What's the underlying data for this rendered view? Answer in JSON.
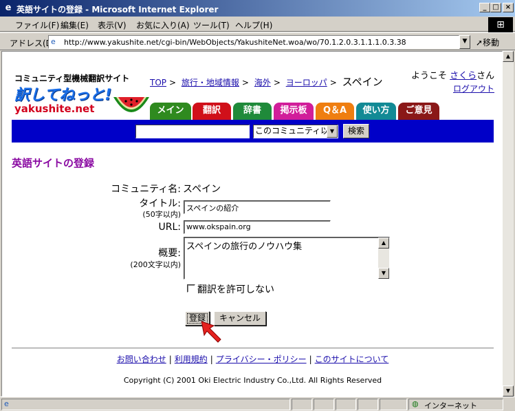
{
  "window": {
    "title": "英語サイトの登録 - Microsoft Internet Explorer",
    "controls": {
      "minimize": "_",
      "maximize": "□",
      "close": "×"
    }
  },
  "menu": {
    "items": [
      "ファイル(F)",
      "編集(E)",
      "表示(V)",
      "お気に入り(A)",
      "ツール(T)",
      "ヘルプ(H)"
    ]
  },
  "address_bar": {
    "label": "アドレス(D)",
    "url": "http://www.yakushite.net/cgi-bin/WebObjects/YakushiteNet.woa/wo/70.1.2.0.3.1.1.1.0.3.38",
    "go_label": "移動"
  },
  "site": {
    "logo_subtitle": "コミュニティ型機械翻訳サイト",
    "logo_main": "訳してねっと!",
    "logo_url": "yakushite.net"
  },
  "breadcrumb": {
    "links": [
      "TOP",
      "旅行・地域情報",
      "海外",
      "ヨーロッパ"
    ],
    "current": "スペイン"
  },
  "user": {
    "welcome_prefix": "ようこそ",
    "username": "さくら",
    "welcome_suffix": "さん",
    "logout_label": "ログアウト"
  },
  "tabs": [
    {
      "label": "メイン",
      "color": "#2f8a1f"
    },
    {
      "label": "翻訳",
      "color": "#d0101a"
    },
    {
      "label": "辞書",
      "color": "#1f8a3a"
    },
    {
      "label": "掲示板",
      "color": "#d11e9a"
    },
    {
      "label": "Q＆A",
      "color": "#ef7e10"
    },
    {
      "label": "使い方",
      "color": "#128a95"
    },
    {
      "label": "ご意見",
      "color": "#8a1818"
    }
  ],
  "search": {
    "input_value": "",
    "scope_selected": "このコミュニティ以下",
    "button_label": "検索"
  },
  "page": {
    "heading": "英語サイトの登録"
  },
  "form": {
    "community_label": "コミュニティ名:",
    "community_value": "スペイン",
    "title_label": "タイトル:",
    "title_hint": "(50字以内)",
    "title_value": "スペインの紹介",
    "url_label": "URL:",
    "url_value": "www.okspain.org",
    "summary_label": "概要:",
    "summary_hint": "(200文字以内)",
    "summary_value": "スペインの旅行のノウハウ集",
    "no_translate_label": "翻訳を許可しない",
    "no_translate_checked": false,
    "submit_label": "登録",
    "cancel_label": "キャンセル"
  },
  "footer": {
    "links": [
      "お問い合わせ",
      "利用規約",
      "プライバシー・ポリシー",
      "このサイトについて"
    ],
    "copyright": "Copyright (C) 2001 Oki Electric Industry Co.,Ltd. All Rights Reserved"
  },
  "status_bar": {
    "zone_label": "インターネット"
  },
  "colors": {
    "accent_purple": "#8a0aa2",
    "nav_blue": "#0000c8",
    "pointer_red": "#e5221f"
  }
}
